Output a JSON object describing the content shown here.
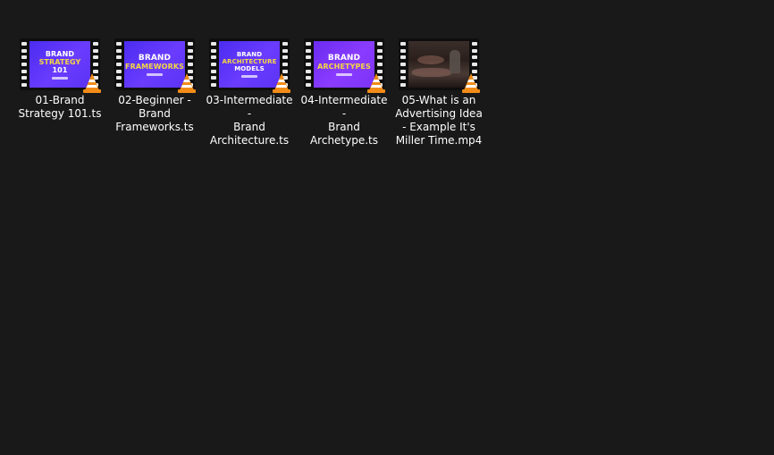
{
  "files": [
    {
      "name": "01-Brand Strategy 101.ts",
      "label_lines": [
        "01-Brand",
        "Strategy 101.ts"
      ],
      "thumb_lines": [
        "BRAND",
        "STRATEGY",
        "101"
      ],
      "thumb_style": "purple"
    },
    {
      "name": "02-Beginner - Brand Frameworks.ts",
      "label_lines": [
        "02-Beginner -",
        "Brand",
        "Frameworks.ts"
      ],
      "thumb_lines": [
        "BRAND",
        "FRAMEWORKS"
      ],
      "thumb_style": "purple"
    },
    {
      "name": "03-Intermediate - Brand Architecture.ts",
      "label_lines": [
        "03-Intermediate -",
        "Brand",
        "Architecture.ts"
      ],
      "thumb_lines": [
        "BRAND",
        "ARCHITECTURE",
        "MODELS"
      ],
      "thumb_style": "purple"
    },
    {
      "name": "04-Intermediate - Brand Archetype.ts",
      "label_lines": [
        "04-Intermediate -",
        "Brand",
        "Archetype.ts"
      ],
      "thumb_lines": [
        "BRAND",
        "ARCHETYPES"
      ],
      "thumb_style": "purple"
    },
    {
      "name": "05-What is an Advertising Idea - Example It's Miller Time.mp4",
      "label_lines": [
        "05-What is an",
        "Advertising Idea",
        "- Example It's",
        "Miller Time.mp4"
      ],
      "thumb_lines": [],
      "thumb_style": "dark"
    }
  ],
  "icons": {
    "overlay": "vlc-cone-icon",
    "frame": "film-strip-icon"
  },
  "colors": {
    "background": "#191919",
    "thumb_purple": "#5b33f5",
    "thumb_yellow": "#f5d742",
    "cone_orange": "#f28c18"
  }
}
